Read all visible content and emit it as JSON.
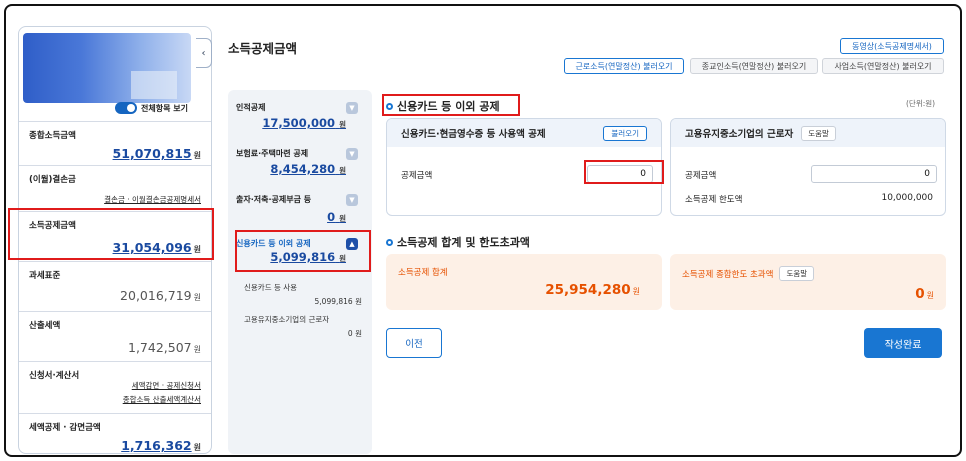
{
  "sidebar": {
    "toggle_label": "전체항목 보기",
    "items": [
      {
        "title": "종합소득금액",
        "value": "51,070,815",
        "unit": "원"
      },
      {
        "title": "(이월)결손금",
        "link": "결손금 · 이월결손금공제명세서"
      },
      {
        "title": "소득공제금액",
        "value": "31,054,096",
        "unit": "원"
      },
      {
        "title": "과세표준",
        "value": "20,016,719",
        "unit": "원"
      },
      {
        "title": "산출세액",
        "value": "1,742,507",
        "unit": "원"
      },
      {
        "title": "신청서·계산서",
        "link1": "세액감면 · 공제신청서",
        "link2": "종합소득 산출세액계산서"
      },
      {
        "title": "세액공제 · 감면금액",
        "value": "1,716,362",
        "unit": "원"
      }
    ]
  },
  "header": {
    "title": "소득공제금액",
    "video_btn": "동영상(소득공제명세서)",
    "load_btns": [
      "근로소득(연말정산) 불러오기",
      "종교인소득(연말정산) 불러오기",
      "사업소득(연말정산) 불러오기"
    ]
  },
  "middle": {
    "items": [
      {
        "title": "인적공제",
        "value": "17,500,000",
        "unit": "원"
      },
      {
        "title": "보험료·주택마련 공제",
        "value": "8,454,280",
        "unit": "원"
      },
      {
        "title": "출자·저축·공제부금 등",
        "value": "0",
        "unit": "원"
      },
      {
        "title": "신용카드 등 이외 공제",
        "value": "5,099,816",
        "unit": "원"
      }
    ],
    "subs": [
      {
        "label": "신용카드 등 사용",
        "value": "5,099,816",
        "unit": "원"
      },
      {
        "label": "고용유지중소기업의 근로자",
        "value": "0",
        "unit": "원"
      }
    ]
  },
  "main": {
    "section1_title": "신용카드 등 이외 공제",
    "unit_note": "(단위:원)",
    "card1": {
      "title": "신용카드·현금영수증 등 사용액 공제",
      "btn": "불러오기",
      "row_label": "공제금액",
      "row_value": "0"
    },
    "card2": {
      "title": "고용유지중소기업의 근로자",
      "btn": "도움말",
      "row1_label": "공제금액",
      "row1_value": "0",
      "row2_label": "소득공제 한도액",
      "row2_value": "10,000,000"
    },
    "section2_title": "소득공제 합계 및 한도초과액",
    "sum1": {
      "label": "소득공제 합계",
      "value": "25,954,280",
      "unit": "원"
    },
    "sum2": {
      "label": "소득공제 종합한도 초과액",
      "btn": "도움말",
      "value": "0",
      "unit": "원"
    },
    "prev_btn": "이전",
    "done_btn": "작성완료"
  },
  "icons": {
    "collapse": "chevron-left-icon",
    "expand": "chevron-down-icon",
    "collapse_up": "chevron-up-icon"
  },
  "colors": {
    "accent": "#1976d2",
    "highlight": "#e01b1b",
    "orange": "#e65100"
  }
}
